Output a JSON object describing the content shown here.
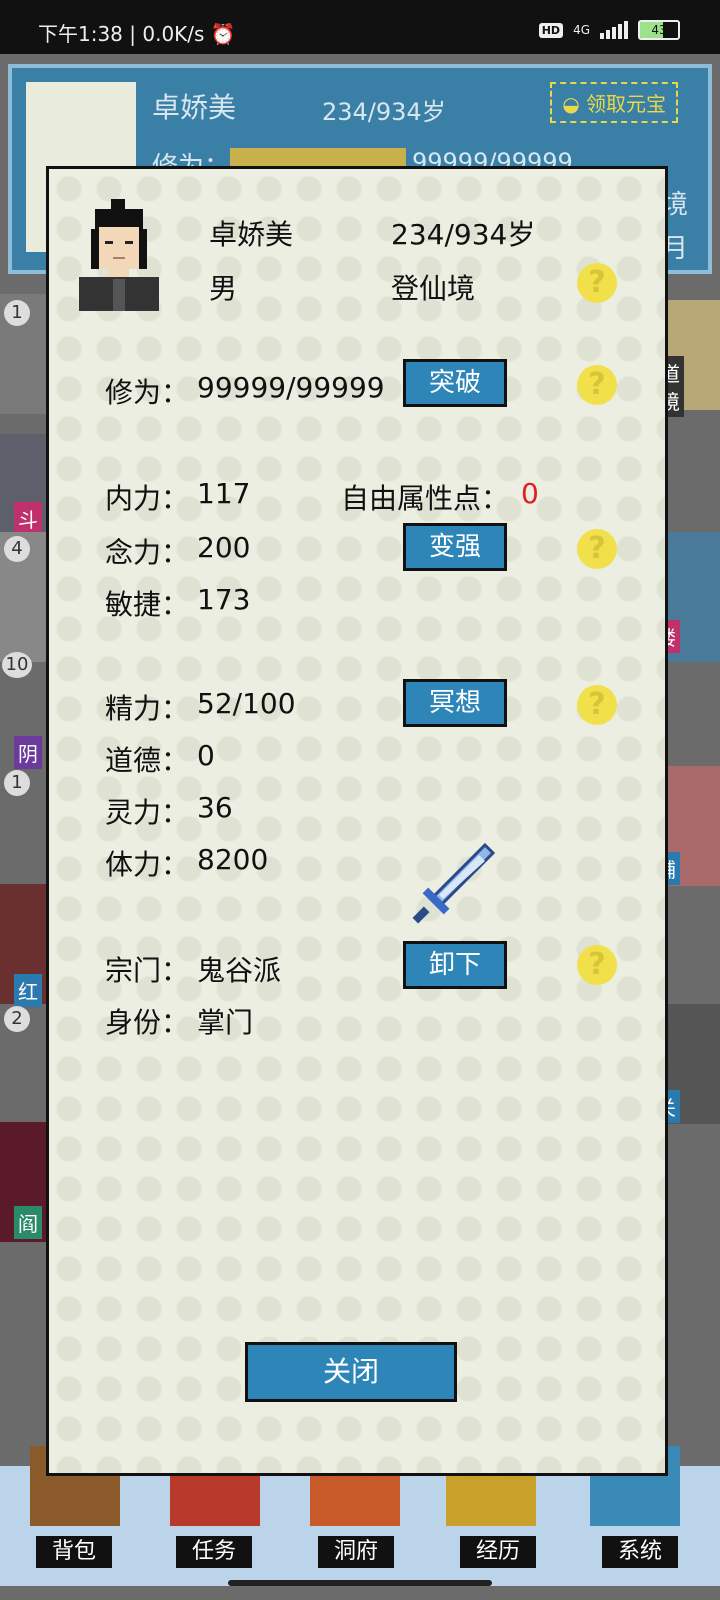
{
  "status_bar": {
    "time": "下午1:38",
    "speed": "0.0K/s",
    "hd": "HD",
    "network": "4G",
    "battery": "43"
  },
  "background": {
    "name": "卓娇美",
    "age": "234/934岁",
    "reward_button": "领取元宝",
    "cultivation_label": "修为：",
    "cultivation_value": "99999/99999",
    "right_edge_texts": [
      "境",
      "月"
    ],
    "side_tags": [
      "斗",
      "阴",
      "红",
      "阎",
      "道",
      "境",
      "楼",
      "铺",
      "关"
    ],
    "side_numbers": [
      "1",
      "4",
      "10",
      "1",
      "2"
    ]
  },
  "modal": {
    "name": "卓娇美",
    "age": "234/934岁",
    "gender": "男",
    "realm": "登仙境",
    "cultivation_label": "修为：",
    "cultivation_value": "99999/99999",
    "breakthrough_button": "突破",
    "stats1": [
      {
        "label": "内力：",
        "value": "117"
      },
      {
        "label": "念力：",
        "value": "200"
      },
      {
        "label": "敏捷：",
        "value": "173"
      }
    ],
    "free_points_label": "自由属性点：",
    "free_points_value": "0",
    "strengthen_button": "变强",
    "stats2": [
      {
        "label": "精力：",
        "value": "52/100"
      },
      {
        "label": "道德：",
        "value": "0"
      },
      {
        "label": "灵力：",
        "value": "36"
      },
      {
        "label": "体力：",
        "value": "8200"
      }
    ],
    "meditate_button": "冥想",
    "sect_label": "宗门：",
    "sect_value": "鬼谷派",
    "identity_label": "身份：",
    "identity_value": "掌门",
    "unequip_button": "卸下",
    "help_icon_text": "?",
    "close_button": "关闭"
  },
  "bottom_nav": [
    "背包",
    "任务",
    "洞府",
    "经历",
    "系统"
  ],
  "colors": {
    "accent_blue": "#2e86b8",
    "help_yellow": "#f2e04a",
    "panel_bg": "#ebeee0"
  }
}
